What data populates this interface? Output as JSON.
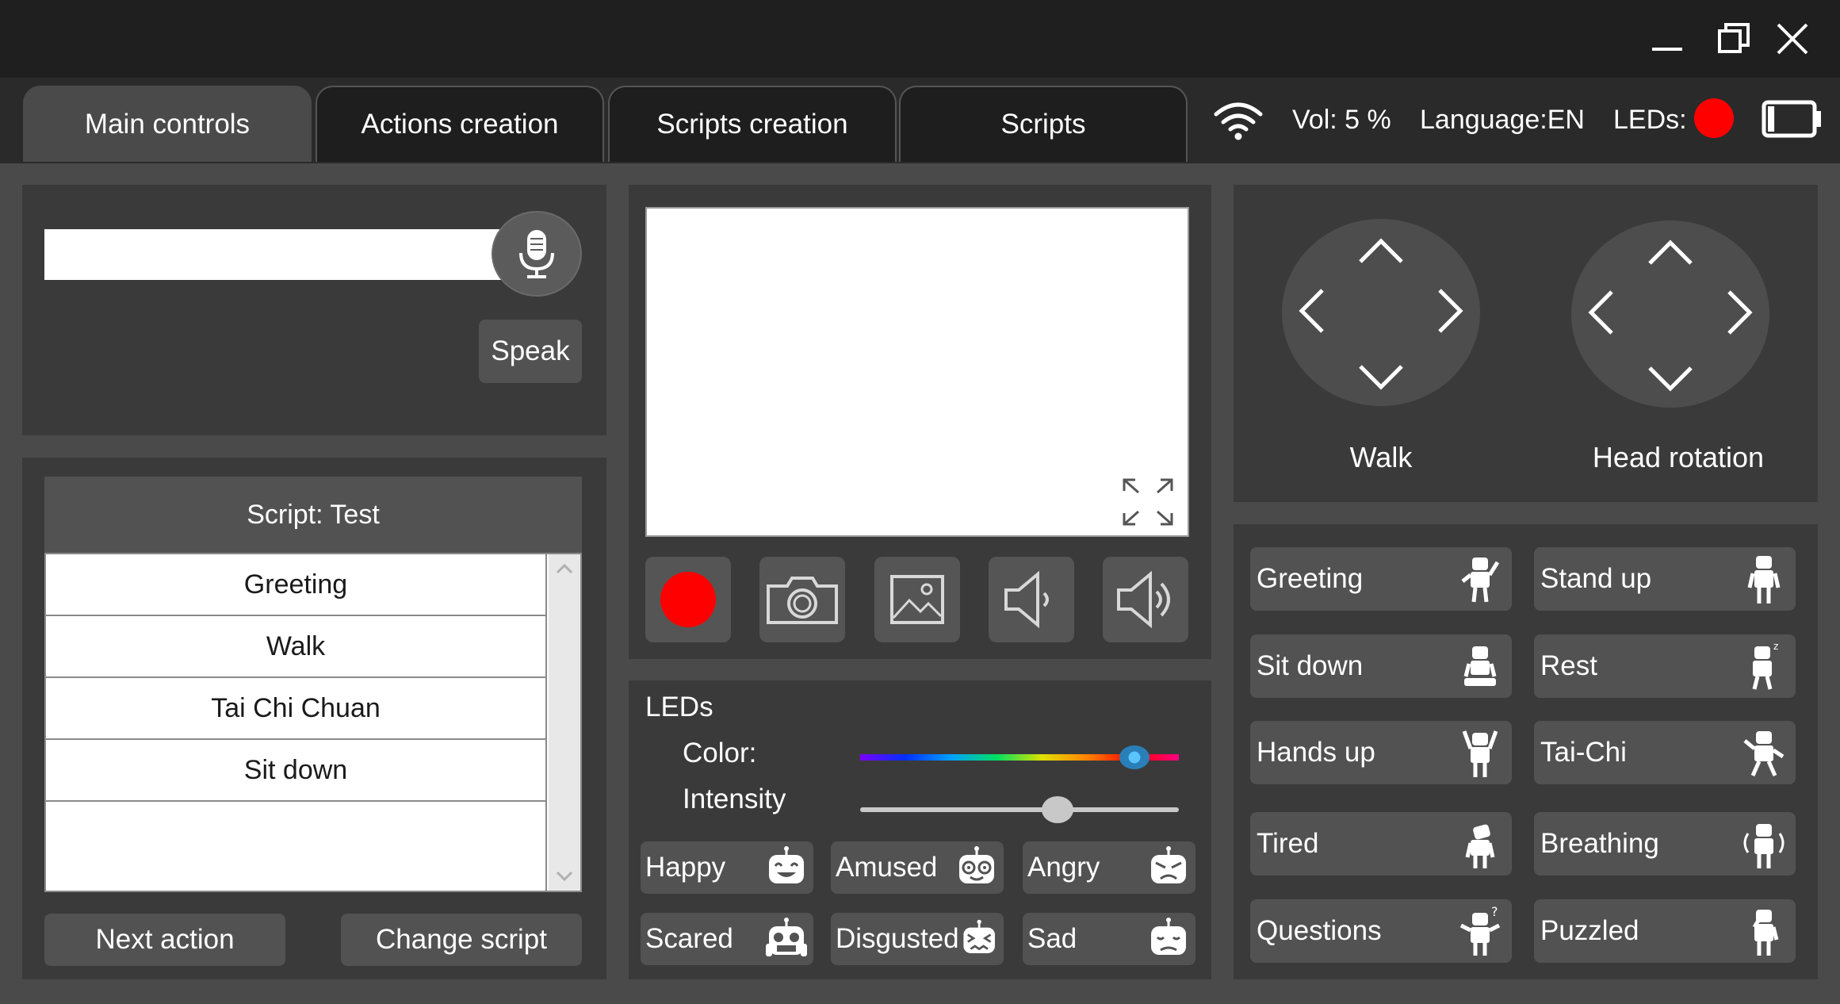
{
  "window": {
    "minimize_icon": "minimize-icon",
    "restore_icon": "restore-icon",
    "close_icon": "close-icon"
  },
  "tabs": [
    {
      "label": "Main controls",
      "active": true
    },
    {
      "label": "Actions creation",
      "active": false
    },
    {
      "label": "Scripts creation",
      "active": false
    },
    {
      "label": "Scripts",
      "active": false
    }
  ],
  "status": {
    "wifi_icon": "wifi-icon",
    "volume": "Vol: 5 %",
    "language": "Language:EN",
    "leds_label": "LEDs:",
    "led_color": "#ff0000",
    "battery_icon": "battery-icon",
    "battery_level": 0.15
  },
  "speech": {
    "input_value": "",
    "mic_icon": "microphone-icon",
    "speak_label": "Speak"
  },
  "script": {
    "title": "Script: Test",
    "items": [
      "Greeting",
      "Walk",
      "Tai Chi Chuan",
      "Sit down"
    ],
    "next_label": "Next action",
    "change_label": "Change script"
  },
  "media": {
    "expand_icon": "expand-icon",
    "buttons": [
      "record-icon",
      "camera-icon",
      "image-icon",
      "volume-down-icon",
      "volume-up-icon"
    ],
    "record_color": "#ff0000"
  },
  "leds": {
    "title": "LEDs",
    "color_label": "Color:",
    "intensity_label": "Intensity",
    "color_position": 0.86,
    "intensity_value": 0.62,
    "emotions": [
      {
        "label": "Happy",
        "icon": "happy-face-icon"
      },
      {
        "label": "Amused",
        "icon": "amused-face-icon"
      },
      {
        "label": "Angry",
        "icon": "angry-face-icon"
      },
      {
        "label": "Scared",
        "icon": "scared-face-icon"
      },
      {
        "label": "Disgusted",
        "icon": "disgusted-face-icon"
      },
      {
        "label": "Sad",
        "icon": "sad-face-icon"
      }
    ]
  },
  "movement": {
    "walk_label": "Walk",
    "head_label": "Head rotation"
  },
  "actions": [
    {
      "label": "Greeting",
      "icon": "robot-greeting-icon"
    },
    {
      "label": "Stand up",
      "icon": "robot-stand-icon"
    },
    {
      "label": "Sit down",
      "icon": "robot-sit-icon"
    },
    {
      "label": "Rest",
      "icon": "robot-rest-icon"
    },
    {
      "label": "Hands up",
      "icon": "robot-hands-up-icon"
    },
    {
      "label": "Tai-Chi",
      "icon": "robot-taichi-icon"
    },
    {
      "label": "Tired",
      "icon": "robot-tired-icon"
    },
    {
      "label": "Breathing",
      "icon": "robot-breathing-icon"
    },
    {
      "label": "Questions",
      "icon": "robot-questions-icon"
    },
    {
      "label": "Puzzled",
      "icon": "robot-puzzled-icon"
    }
  ]
}
